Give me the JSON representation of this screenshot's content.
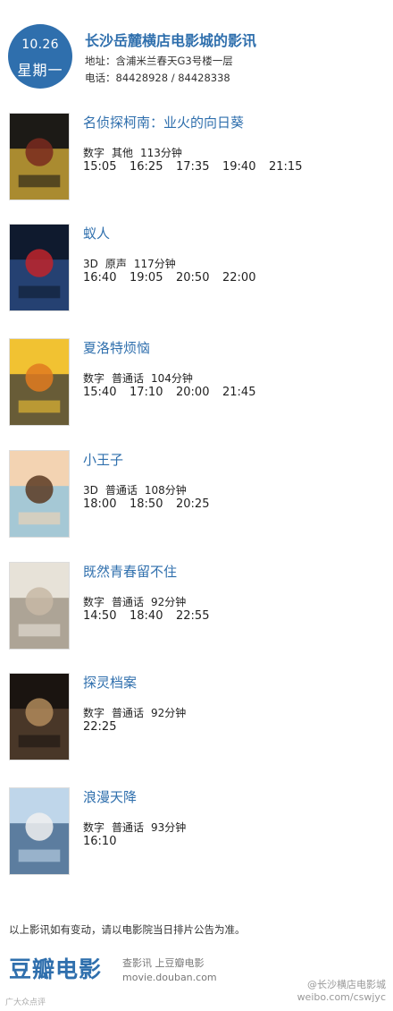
{
  "header": {
    "date": "10.26",
    "weekday": "星期一",
    "cinema_name": "长沙岳麓横店电影城的影讯",
    "address": "地址：含浦米兰春天G3号楼一层",
    "phone": "电话：84428928 / 84428338"
  },
  "movies": [
    {
      "title": "名侦探柯南：业火的向日葵",
      "format": "数字",
      "language": "其他",
      "duration": "113分钟",
      "times": [
        "15:05",
        "16:25",
        "17:35",
        "19:40",
        "21:15"
      ],
      "poster_colors": [
        "#1c1a16",
        "#d9b23a",
        "#7a2a1f"
      ]
    },
    {
      "title": "蚁人",
      "format": "3D",
      "language": "原声",
      "duration": "117分钟",
      "times": [
        "16:40",
        "19:05",
        "20:50",
        "22:00"
      ],
      "poster_colors": [
        "#0f1a2e",
        "#2d4f8a",
        "#c0242a"
      ]
    },
    {
      "title": "夏洛特烦恼",
      "format": "数字",
      "language": "普通话",
      "duration": "104分钟",
      "times": [
        "15:40",
        "17:10",
        "20:00",
        "21:45"
      ],
      "poster_colors": [
        "#f1c232",
        "#3a3a3a",
        "#e07a20"
      ]
    },
    {
      "title": "小王子",
      "format": "3D",
      "language": "普通话",
      "duration": "108分钟",
      "times": [
        "18:00",
        "18:50",
        "20:25"
      ],
      "poster_colors": [
        "#f3d3b2",
        "#8bc4e0",
        "#5a3a22"
      ]
    },
    {
      "title": "既然青春留不住",
      "format": "数字",
      "language": "普通话",
      "duration": "92分钟",
      "times": [
        "14:50",
        "18:40",
        "22:55"
      ],
      "poster_colors": [
        "#e7e2d8",
        "#9a8f80",
        "#c7b9a6"
      ]
    },
    {
      "title": "探灵档案",
      "format": "数字",
      "language": "普通话",
      "duration": "92分钟",
      "times": [
        "22:25"
      ],
      "poster_colors": [
        "#1a1410",
        "#5a4330",
        "#b08a5a"
      ]
    },
    {
      "title": "浪漫天降",
      "format": "数字",
      "language": "普通话",
      "duration": "93分钟",
      "times": [
        "16:10"
      ],
      "poster_colors": [
        "#bfd6ea",
        "#3b5f86",
        "#f0f0f0"
      ]
    }
  ],
  "footer": {
    "note": "以上影讯如有变动，请以电影院当日排片公告为准。",
    "brand": "豆瓣电影",
    "tagline": "查影讯  上豆瓣电影",
    "url": "movie.douban.com",
    "watermark_left": "广大众点评",
    "watermark_right_1": "@长沙横店电影城",
    "watermark_right_2": "weibo.com/cswjyc"
  },
  "colors": {
    "accent": "#2f6fad"
  }
}
